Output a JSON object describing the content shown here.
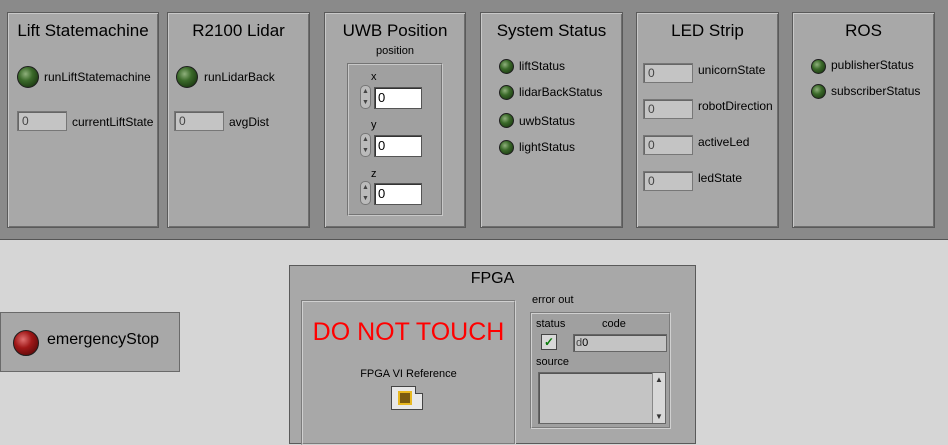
{
  "panels": {
    "lift": {
      "title": "Lift Statemachine",
      "led_label": "runLiftStatemachine",
      "num_value": "0",
      "num_label": "currentLiftState"
    },
    "lidar": {
      "title": "R2100 Lidar",
      "led_label": "runLidarBack",
      "num_value": "0",
      "num_label": "avgDist"
    },
    "uwb": {
      "title": "UWB Position",
      "cluster_label": "position",
      "fields": [
        {
          "label": "x",
          "value": "0"
        },
        {
          "label": "y",
          "value": "0"
        },
        {
          "label": "z",
          "value": "0"
        }
      ]
    },
    "system": {
      "title": "System Status",
      "leds": [
        "liftStatus",
        "lidarBackStatus",
        "uwbStatus",
        "lightStatus"
      ]
    },
    "led_strip": {
      "title": "LED Strip",
      "fields": [
        {
          "label": "unicornState",
          "value": "0"
        },
        {
          "label": "robotDirection",
          "value": "0"
        },
        {
          "label": "activeLed",
          "value": "0"
        },
        {
          "label": "ledState",
          "value": "0"
        }
      ]
    },
    "ros": {
      "title": "ROS",
      "leds": [
        "publisherStatus",
        "subscriberStatus"
      ]
    }
  },
  "emergency": {
    "label": "emergencyStop"
  },
  "fpga": {
    "title": "FPGA",
    "warning": "DO NOT TOUCH",
    "ref_label": "FPGA VI Reference",
    "error_out": {
      "title": "error out",
      "status_label": "status",
      "code_label": "code",
      "code_value": "0",
      "code_prefix": "d",
      "source_label": "source",
      "status_ok": true
    }
  },
  "colors": {
    "led_off": "#2e5a1e",
    "warning": "#ff0000",
    "estop": "#a01818"
  },
  "icons": {
    "spin": "spinner-arrows-icon",
    "check": "check-icon",
    "fpga_ref": "fpga-chip-icon"
  }
}
